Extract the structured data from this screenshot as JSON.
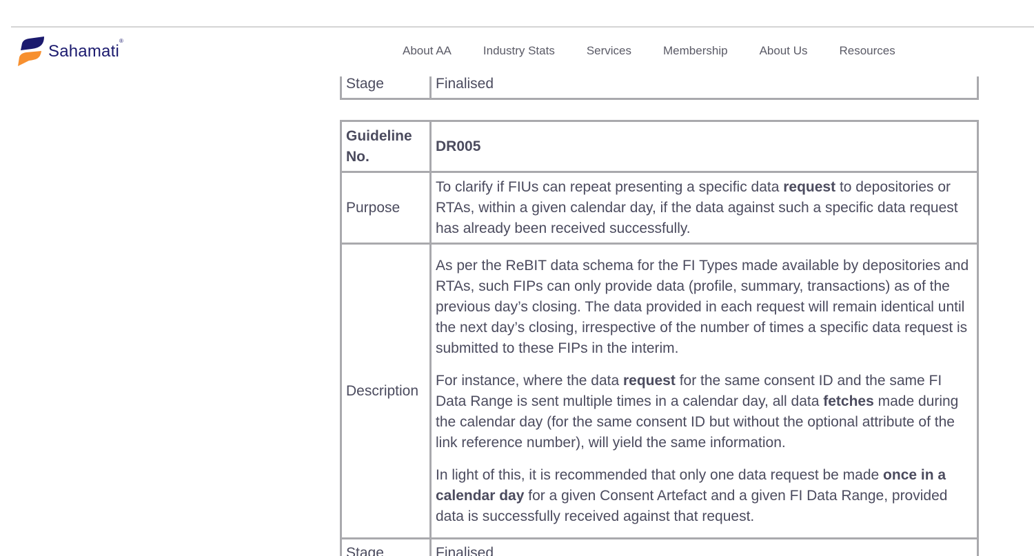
{
  "header": {
    "logo_text": "Sahamati",
    "logo_reg": "®",
    "nav": [
      "About AA",
      "Industry Stats",
      "Services",
      "Membership",
      "About Us",
      "Resources"
    ]
  },
  "colors": {
    "brand_navy": "#1b1a6e",
    "brand_orange": "#f7902f",
    "border": "#a9a9ad",
    "text": "#4b4b5e"
  },
  "table_prev": {
    "stage_label": "Stage",
    "stage_value": "Finalised"
  },
  "table": {
    "guideline_label": "Guideline No.",
    "guideline_value": "DR005",
    "purpose_label": "Purpose",
    "purpose": [
      "To clarify if FIUs can repeat presenting a specific data ",
      "request",
      " to depositories or RTAs, within a given calendar day, if the data against such a specific data request has already been received successfully."
    ],
    "description_label": "Description",
    "description_p1": "As per the ReBIT data schema for the FI Types made available by depositories and RTAs, such FIPs can only provide data (profile, summary, transactions) as of the previous day’s closing. The data provided in each request will remain identical until the next day’s closing, irrespective of the number of times a specific data request is submitted to these FIPs in the interim.",
    "description_p2": [
      "For instance, where the data ",
      "request",
      " for the same consent ID and the same FI Data Range is sent multiple times in a calendar day, all data ",
      "fetches",
      " made during the calendar day (for the same consent ID but without the optional attribute of the link reference number), will yield the same information."
    ],
    "description_p3": [
      "In light of this, it is recommended that only one data request be made ",
      "once in a calendar day",
      " for a given Consent Artefact and a given FI Data Range, provided data is successfully received against that request."
    ],
    "stage_label": "Stage",
    "stage_value": "Finalised"
  }
}
